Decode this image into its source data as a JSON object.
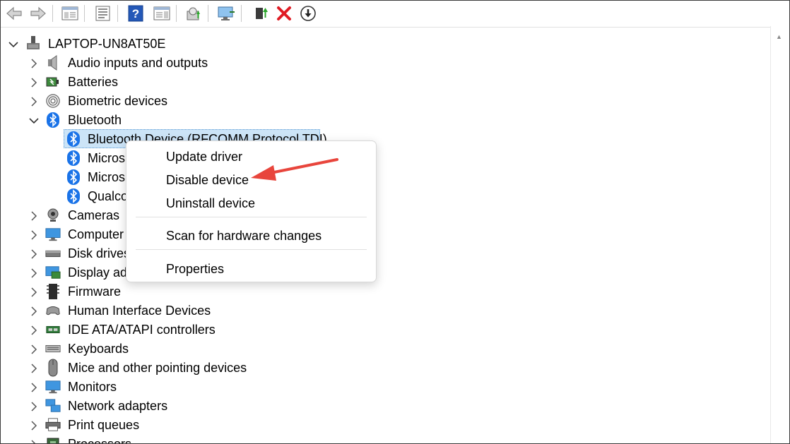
{
  "toolbar": {
    "buttons": [
      {
        "name": "back-arrow-icon"
      },
      {
        "name": "forward-arrow-icon"
      },
      {
        "name": "show-hide-console-tree-icon"
      },
      {
        "name": "properties-sheet-icon"
      },
      {
        "name": "help-icon",
        "glyph": "?"
      },
      {
        "name": "action-pane-icon"
      },
      {
        "name": "update-driver-icon"
      },
      {
        "name": "scan-hardware-icon"
      },
      {
        "name": "enable-device-icon"
      },
      {
        "name": "uninstall-device-icon",
        "glyph": "✕"
      },
      {
        "name": "disable-device-icon",
        "glyph": "↓"
      }
    ],
    "accent_red": "#e01b24",
    "accent_blue": "#1f5fbf"
  },
  "tree": {
    "root": "LAPTOP-UN8AT50E",
    "categories": [
      {
        "label": "Audio inputs and outputs",
        "icon": "speaker-icon"
      },
      {
        "label": "Batteries",
        "icon": "battery-icon"
      },
      {
        "label": "Biometric devices",
        "icon": "fingerprint-icon"
      },
      {
        "label": "Bluetooth",
        "icon": "bluetooth-icon",
        "expanded": true
      },
      {
        "label": "Cameras",
        "icon": "camera-icon"
      },
      {
        "label": "Computer",
        "icon": "computer-icon"
      },
      {
        "label": "Disk drives",
        "icon": "disk-drive-icon"
      },
      {
        "label": "Display ad",
        "icon": "display-adapter-icon"
      },
      {
        "label": "Firmware",
        "icon": "firmware-icon"
      },
      {
        "label": "Human Interface Devices",
        "icon": "hid-icon"
      },
      {
        "label": "IDE ATA/ATAPI controllers",
        "icon": "ide-controller-icon"
      },
      {
        "label": "Keyboards",
        "icon": "keyboard-icon"
      },
      {
        "label": "Mice and other pointing devices",
        "icon": "mouse-icon"
      },
      {
        "label": "Monitors",
        "icon": "monitor-icon"
      },
      {
        "label": "Network adapters",
        "icon": "network-adapter-icon"
      },
      {
        "label": "Print queues",
        "icon": "printer-icon"
      },
      {
        "label": "Processors",
        "icon": "processor-icon"
      }
    ],
    "bluetooth_children": [
      "Bluetooth Device (RFCOMM Protocol TDI)",
      "Micros",
      "Micros",
      "Qualco"
    ]
  },
  "context_menu": {
    "items": [
      "Update driver",
      "Disable device",
      "Uninstall device",
      "Scan for hardware changes",
      "Properties"
    ],
    "annotation_color": "#e8453c"
  },
  "colors": {
    "selection_bg": "#cce4f7",
    "bluetooth_blue": "#1a73e8"
  }
}
